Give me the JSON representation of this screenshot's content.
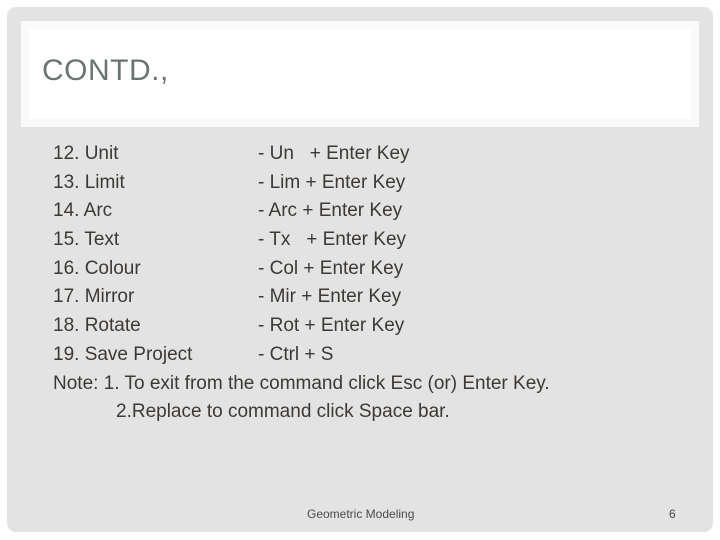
{
  "slide": {
    "title": "CONTD.,",
    "commands": [
      {
        "item": "12. Unit",
        "shortcut": "- Un   + Enter Key"
      },
      {
        "item": "13. Limit",
        "shortcut": "- Lim + Enter Key"
      },
      {
        "item": "14. Arc",
        "shortcut": "- Arc + Enter Key"
      },
      {
        "item": "15. Text",
        "shortcut": "- Tx   + Enter Key"
      },
      {
        "item": "16. Colour",
        "shortcut": "- Col + Enter Key"
      },
      {
        "item": "17. Mirror",
        "shortcut": "- Mir + Enter Key"
      },
      {
        "item": "18. Rotate",
        "shortcut": "- Rot + Enter Key"
      },
      {
        "item": "19. Save Project",
        "shortcut": "- Ctrl + S"
      }
    ],
    "notes": [
      "Note: 1. To exit from the command click Esc (or) Enter Key.",
      "2.Replace to command click Space bar."
    ],
    "footer": {
      "text": "Geometric Modeling",
      "page_number": "6"
    }
  },
  "colors": {
    "panel": "#e3e3e3",
    "title_box": "#ffffff",
    "title_text": "#6b7470",
    "body_text": "#3d3935"
  }
}
